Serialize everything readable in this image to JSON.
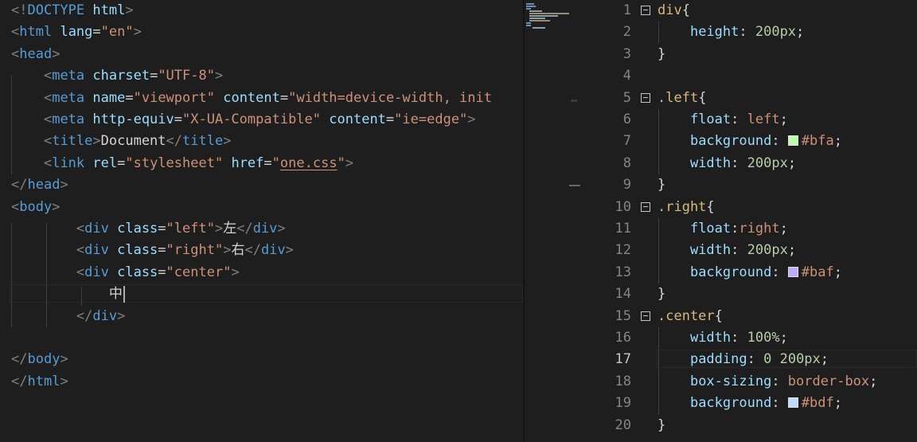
{
  "html_editor": {
    "lines": [
      [
        [
          "t-punc",
          "<!"
        ],
        [
          "t-tag",
          "DOCTYPE"
        ],
        [
          "t-text",
          " "
        ],
        [
          "t-attr",
          "html"
        ],
        [
          "t-punc",
          ">"
        ]
      ],
      [
        [
          "t-punc",
          "<"
        ],
        [
          "t-tag",
          "html"
        ],
        [
          "t-text",
          " "
        ],
        [
          "t-attr",
          "lang"
        ],
        [
          "t-text",
          "="
        ],
        [
          "t-str",
          "\"en\""
        ],
        [
          "t-punc",
          ">"
        ]
      ],
      [
        [
          "t-punc",
          "<"
        ],
        [
          "t-tag",
          "head"
        ],
        [
          "t-punc",
          ">"
        ]
      ],
      [
        [
          "t-text",
          "    "
        ],
        [
          "t-punc",
          "<"
        ],
        [
          "t-tag",
          "meta"
        ],
        [
          "t-text",
          " "
        ],
        [
          "t-attr",
          "charset"
        ],
        [
          "t-text",
          "="
        ],
        [
          "t-str",
          "\"UTF-8\""
        ],
        [
          "t-punc",
          ">"
        ]
      ],
      [
        [
          "t-text",
          "    "
        ],
        [
          "t-punc",
          "<"
        ],
        [
          "t-tag",
          "meta"
        ],
        [
          "t-text",
          " "
        ],
        [
          "t-attr",
          "name"
        ],
        [
          "t-text",
          "="
        ],
        [
          "t-str",
          "\"viewport\""
        ],
        [
          "t-text",
          " "
        ],
        [
          "t-attr",
          "content"
        ],
        [
          "t-text",
          "="
        ],
        [
          "t-str",
          "\"width=device-width, init"
        ]
      ],
      [
        [
          "t-text",
          "    "
        ],
        [
          "t-punc",
          "<"
        ],
        [
          "t-tag",
          "meta"
        ],
        [
          "t-text",
          " "
        ],
        [
          "t-attr",
          "http-equiv"
        ],
        [
          "t-text",
          "="
        ],
        [
          "t-str",
          "\"X-UA-Compatible\""
        ],
        [
          "t-text",
          " "
        ],
        [
          "t-attr",
          "content"
        ],
        [
          "t-text",
          "="
        ],
        [
          "t-str",
          "\"ie=edge\""
        ],
        [
          "t-punc",
          ">"
        ]
      ],
      [
        [
          "t-text",
          "    "
        ],
        [
          "t-punc",
          "<"
        ],
        [
          "t-tag",
          "title"
        ],
        [
          "t-punc",
          ">"
        ],
        [
          "t-text",
          "Document"
        ],
        [
          "t-punc",
          "</"
        ],
        [
          "t-tag",
          "title"
        ],
        [
          "t-punc",
          ">"
        ]
      ],
      [
        [
          "t-text",
          "    "
        ],
        [
          "t-punc",
          "<"
        ],
        [
          "t-tag",
          "link"
        ],
        [
          "t-text",
          " "
        ],
        [
          "t-attr",
          "rel"
        ],
        [
          "t-text",
          "="
        ],
        [
          "t-str",
          "\"stylesheet\""
        ],
        [
          "t-text",
          " "
        ],
        [
          "t-attr",
          "href"
        ],
        [
          "t-text",
          "="
        ],
        [
          "t-str",
          "\""
        ],
        [
          "t-str t-link",
          "one.css"
        ],
        [
          "t-str",
          "\""
        ],
        [
          "t-punc",
          ">"
        ]
      ],
      [
        [
          "t-punc",
          "</"
        ],
        [
          "t-tag",
          "head"
        ],
        [
          "t-punc",
          ">"
        ]
      ],
      [
        [
          "t-punc",
          "<"
        ],
        [
          "t-tag",
          "body"
        ],
        [
          "t-punc",
          ">"
        ]
      ],
      [
        [
          "t-text",
          "        "
        ],
        [
          "t-punc",
          "<"
        ],
        [
          "t-tag",
          "div"
        ],
        [
          "t-text",
          " "
        ],
        [
          "t-attr",
          "class"
        ],
        [
          "t-text",
          "="
        ],
        [
          "t-str",
          "\"left\""
        ],
        [
          "t-punc",
          ">"
        ],
        [
          "t-text",
          "左"
        ],
        [
          "t-punc",
          "</"
        ],
        [
          "t-tag",
          "div"
        ],
        [
          "t-punc",
          ">"
        ]
      ],
      [
        [
          "t-text",
          "        "
        ],
        [
          "t-punc",
          "<"
        ],
        [
          "t-tag",
          "div"
        ],
        [
          "t-text",
          " "
        ],
        [
          "t-attr",
          "class"
        ],
        [
          "t-text",
          "="
        ],
        [
          "t-str",
          "\"right\""
        ],
        [
          "t-punc",
          ">"
        ],
        [
          "t-text",
          "右"
        ],
        [
          "t-punc",
          "</"
        ],
        [
          "t-tag",
          "div"
        ],
        [
          "t-punc",
          ">"
        ]
      ],
      [
        [
          "t-text",
          "        "
        ],
        [
          "t-punc",
          "<"
        ],
        [
          "t-tag",
          "div"
        ],
        [
          "t-text",
          " "
        ],
        [
          "t-attr",
          "class"
        ],
        [
          "t-text",
          "="
        ],
        [
          "t-str",
          "\"center\""
        ],
        [
          "t-punc",
          ">"
        ]
      ],
      [
        [
          "t-text",
          "            中"
        ]
      ],
      [
        [
          "t-text",
          "        "
        ],
        [
          "t-punc",
          "</"
        ],
        [
          "t-tag",
          "div"
        ],
        [
          "t-punc",
          ">"
        ]
      ],
      [],
      [
        [
          "t-punc",
          "</"
        ],
        [
          "t-tag",
          "body"
        ],
        [
          "t-punc",
          ">"
        ]
      ],
      [
        [
          "t-punc",
          "</"
        ],
        [
          "t-tag",
          "html"
        ],
        [
          "t-punc",
          ">"
        ]
      ]
    ],
    "cursor_line": 14
  },
  "css_editor": {
    "active_line": 17,
    "lines": [
      {
        "n": "1",
        "fold": true,
        "tokens": [
          [
            "t-sel",
            "div"
          ],
          [
            "t-text",
            "{"
          ]
        ]
      },
      {
        "n": "2",
        "tokens": [
          [
            "t-text",
            "    "
          ],
          [
            "t-prop",
            "height"
          ],
          [
            "t-text",
            ": "
          ],
          [
            "t-num",
            "200px"
          ],
          [
            "t-text",
            ";"
          ]
        ]
      },
      {
        "n": "3",
        "tokens": [
          [
            "t-text",
            "}"
          ]
        ]
      },
      {
        "n": "4",
        "tokens": []
      },
      {
        "n": "5",
        "fold": true,
        "tokens": [
          [
            "t-sel",
            ".left"
          ],
          [
            "t-text",
            "{"
          ]
        ]
      },
      {
        "n": "6",
        "tokens": [
          [
            "t-text",
            "    "
          ],
          [
            "t-prop",
            "float"
          ],
          [
            "t-text",
            ": "
          ],
          [
            "t-val",
            "left"
          ],
          [
            "t-text",
            ";"
          ]
        ]
      },
      {
        "n": "7",
        "tokens": [
          [
            "t-text",
            "    "
          ],
          [
            "t-prop",
            "background"
          ],
          [
            "t-text",
            ": "
          ],
          [
            "swatch",
            "#bbffaa"
          ],
          [
            "t-val",
            "#bfa"
          ],
          [
            "t-text",
            ";"
          ]
        ]
      },
      {
        "n": "8",
        "tokens": [
          [
            "t-text",
            "    "
          ],
          [
            "t-prop",
            "width"
          ],
          [
            "t-text",
            ": "
          ],
          [
            "t-num",
            "200px"
          ],
          [
            "t-text",
            ";"
          ]
        ]
      },
      {
        "n": "9",
        "tokens": [
          [
            "t-text",
            "}"
          ]
        ]
      },
      {
        "n": "10",
        "fold": true,
        "tokens": [
          [
            "t-sel",
            ".right"
          ],
          [
            "t-text",
            "{"
          ]
        ]
      },
      {
        "n": "11",
        "tokens": [
          [
            "t-text",
            "    "
          ],
          [
            "t-prop",
            "float"
          ],
          [
            "t-text",
            ":"
          ],
          [
            "t-val",
            "right"
          ],
          [
            "t-text",
            ";"
          ]
        ]
      },
      {
        "n": "12",
        "tokens": [
          [
            "t-text",
            "    "
          ],
          [
            "t-prop",
            "width"
          ],
          [
            "t-text",
            ": "
          ],
          [
            "t-num",
            "200px"
          ],
          [
            "t-text",
            ";"
          ]
        ]
      },
      {
        "n": "13",
        "tokens": [
          [
            "t-text",
            "    "
          ],
          [
            "t-prop",
            "background"
          ],
          [
            "t-text",
            ": "
          ],
          [
            "swatch",
            "#bbaaff"
          ],
          [
            "t-val",
            "#baf"
          ],
          [
            "t-text",
            ";"
          ]
        ]
      },
      {
        "n": "14",
        "tokens": [
          [
            "t-text",
            "}"
          ]
        ]
      },
      {
        "n": "15",
        "fold": true,
        "tokens": [
          [
            "t-sel",
            ".center"
          ],
          [
            "t-text",
            "{"
          ]
        ]
      },
      {
        "n": "16",
        "tokens": [
          [
            "t-text",
            "    "
          ],
          [
            "t-prop",
            "width"
          ],
          [
            "t-text",
            ": "
          ],
          [
            "t-num",
            "100%"
          ],
          [
            "t-text",
            ";"
          ]
        ]
      },
      {
        "n": "17",
        "tokens": [
          [
            "t-text",
            "    "
          ],
          [
            "t-prop",
            "padding"
          ],
          [
            "t-text",
            ": "
          ],
          [
            "t-num",
            "0"
          ],
          [
            "t-text",
            " "
          ],
          [
            "t-num",
            "200px"
          ],
          [
            "t-text",
            ";"
          ]
        ]
      },
      {
        "n": "18",
        "tokens": [
          [
            "t-text",
            "    "
          ],
          [
            "t-prop",
            "box-sizing"
          ],
          [
            "t-text",
            ": "
          ],
          [
            "t-val",
            "border-box"
          ],
          [
            "t-text",
            ";"
          ]
        ]
      },
      {
        "n": "19",
        "tokens": [
          [
            "t-text",
            "    "
          ],
          [
            "t-prop",
            "background"
          ],
          [
            "t-text",
            ": "
          ],
          [
            "swatch",
            "#bbddff"
          ],
          [
            "t-val",
            "#bdf"
          ],
          [
            "t-text",
            ";"
          ]
        ]
      },
      {
        "n": "20",
        "tokens": [
          [
            "t-text",
            "}"
          ]
        ]
      }
    ]
  },
  "colors": {
    "editor_bg": "#1e1e1e",
    "tag": "#569cd6",
    "attribute": "#9cdcfe",
    "string": "#ce9178",
    "selector": "#d7ba7d",
    "number": "#b5cea8"
  }
}
